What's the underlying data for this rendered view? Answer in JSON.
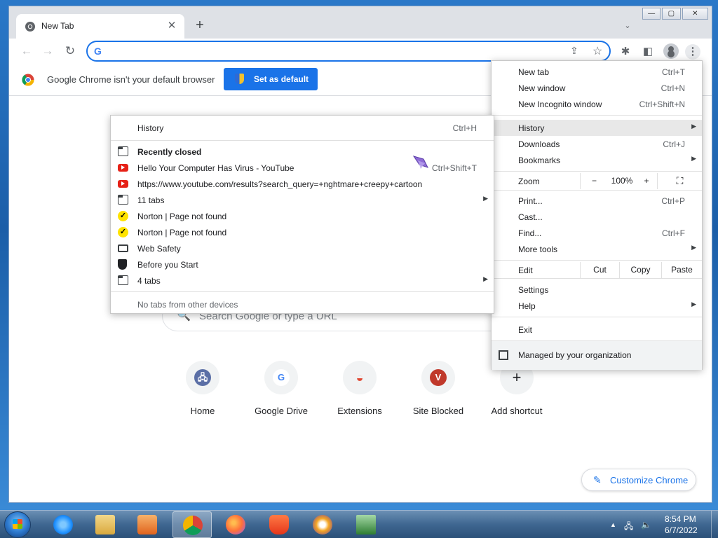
{
  "colors": {
    "accent": "#1a73e8",
    "youtube": "#e62117",
    "norton": "#ffe300"
  },
  "tab": {
    "title": "New Tab",
    "close": "✕",
    "new_tab": "+",
    "search_tabs": "⌄"
  },
  "window_controls": {
    "minimize": "—",
    "maximize": "▢",
    "close": "✕"
  },
  "toolbar": {
    "back": "←",
    "forward": "→",
    "reload": "↻",
    "omnibox_value": "",
    "omnibox_g": "G",
    "share": "⇪",
    "star": "☆",
    "extensions": "✱",
    "sidepanel": "◧",
    "menu": "⋮"
  },
  "infobar": {
    "message": "Google Chrome isn't your default browser",
    "button": "Set as default"
  },
  "ntp": {
    "search_placeholder": "Search Google or type a URL",
    "search_icon": "🔍",
    "shortcuts": [
      {
        "label": "Home",
        "icon": "🖧",
        "icon_color": "#5b6fa6"
      },
      {
        "label": "Google Drive",
        "icon": "G",
        "icon_color": "#4285f4"
      },
      {
        "label": "Extensions",
        "icon": "◒",
        "icon_color": "#e0452f"
      },
      {
        "label": "Site Blocked",
        "icon": "V",
        "icon_color": "#c0392b"
      },
      {
        "label": "Add shortcut",
        "icon": "+",
        "icon_color": "#202124"
      }
    ],
    "customize": "Customize Chrome",
    "customize_icon": "✎"
  },
  "main_menu": {
    "new_tab": "New tab",
    "new_tab_sc": "Ctrl+T",
    "new_window": "New window",
    "new_window_sc": "Ctrl+N",
    "incognito": "New Incognito window",
    "incognito_sc": "Ctrl+Shift+N",
    "history": "History",
    "downloads": "Downloads",
    "downloads_sc": "Ctrl+J",
    "bookmarks": "Bookmarks",
    "zoom": "Zoom",
    "zoom_minus": "−",
    "zoom_value": "100%",
    "zoom_plus": "+",
    "fullscreen": "⛶",
    "print": "Print...",
    "print_sc": "Ctrl+P",
    "cast": "Cast...",
    "find": "Find...",
    "find_sc": "Ctrl+F",
    "more_tools": "More tools",
    "edit": "Edit",
    "cut": "Cut",
    "copy": "Copy",
    "paste": "Paste",
    "settings": "Settings",
    "help": "Help",
    "exit": "Exit",
    "managed": "Managed by your organization",
    "arrow": "▶"
  },
  "history_menu": {
    "history": "History",
    "history_sc": "Ctrl+H",
    "recently_closed": "Recently closed",
    "items": [
      {
        "label": "Hello Your Computer Has Virus - YouTube",
        "icon": "youtube",
        "shortcut": "Ctrl+Shift+T"
      },
      {
        "label": "https://www.youtube.com/results?search_query=+nghtmare+creepy+cartoon",
        "icon": "youtube",
        "shortcut": ""
      },
      {
        "label": "11 tabs",
        "icon": "tabs",
        "shortcut": ""
      },
      {
        "label": "Norton | Page not found",
        "icon": "norton",
        "shortcut": ""
      },
      {
        "label": "Norton | Page not found",
        "icon": "norton",
        "shortcut": ""
      },
      {
        "label": "Web Safety",
        "icon": "websafety",
        "shortcut": ""
      },
      {
        "label": "Before you Start",
        "icon": "shield",
        "shortcut": ""
      },
      {
        "label": "4 tabs",
        "icon": "tabs",
        "shortcut": ""
      }
    ],
    "check": "✓",
    "footer": "No tabs from other devices",
    "arrow": "▶"
  },
  "taskbar": {
    "apps": [
      {
        "name": "Internet Explorer",
        "color": "#1e90ff",
        "active": false
      },
      {
        "name": "Windows Explorer",
        "color": "#e8c25a",
        "active": false
      },
      {
        "name": "Windows Media Player",
        "color": "#f08a24",
        "active": false
      },
      {
        "name": "Google Chrome",
        "color": "#4285f4",
        "active": true
      },
      {
        "name": "Firefox",
        "color": "#ff7139",
        "active": false
      },
      {
        "name": "Brave",
        "color": "#fb542b",
        "active": false
      },
      {
        "name": "Avast Secure Browser",
        "color": "#f5a623",
        "active": false
      },
      {
        "name": "Task Manager",
        "color": "#4caf50",
        "active": false
      }
    ],
    "tray_up": "▲",
    "tray_network": "🖧",
    "tray_volume": "🔈",
    "time": "8:54 PM",
    "date": "6/7/2022"
  }
}
